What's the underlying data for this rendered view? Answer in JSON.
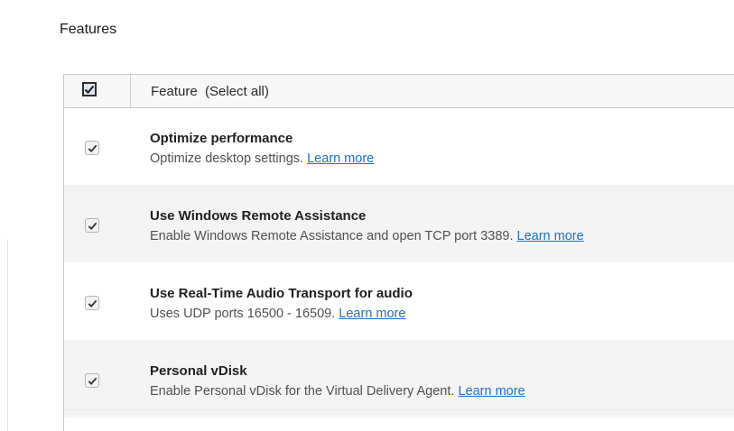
{
  "section": {
    "title": "Features"
  },
  "table": {
    "header": {
      "select_all_checked": true,
      "label": "Feature  (Select all)"
    },
    "rows": [
      {
        "title": "Optimize performance",
        "description": "Optimize desktop settings.",
        "link": "Learn more",
        "checked": true
      },
      {
        "title": "Use Windows Remote Assistance",
        "description": "Enable Windows Remote Assistance and open TCP port 3389.",
        "link": "Learn more",
        "checked": true
      },
      {
        "title": "Use Real-Time Audio Transport for audio",
        "description": "Uses UDP ports 16500 - 16509.",
        "link": "Learn more",
        "checked": true
      },
      {
        "title": "Personal vDisk",
        "description": "Enable Personal vDisk for the Virtual Delivery Agent.",
        "link": "Learn more",
        "checked": true
      }
    ]
  },
  "colors": {
    "link": "#1d6fc8",
    "alt_row": "#f4f4f4",
    "header_bg": "#f7f7f7"
  },
  "icons": {
    "select_all": "checkmark-icon",
    "row_check": "checkmark-icon"
  }
}
